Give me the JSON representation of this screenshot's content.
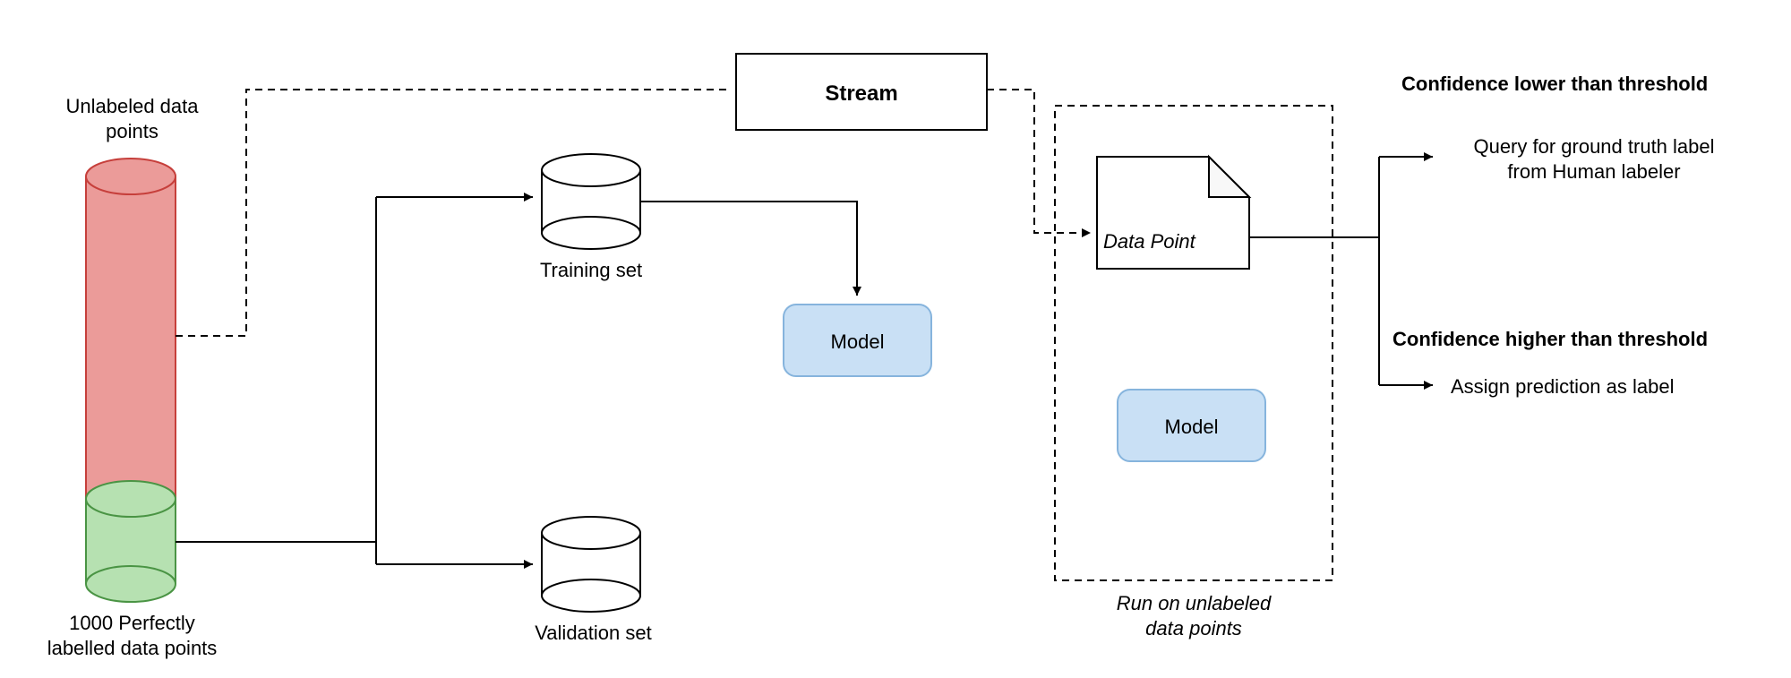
{
  "labels": {
    "unlabeled_title": "Unlabeled data\npoints",
    "labeled_title": "1000 Perfectly\nlabelled data points",
    "training_set": "Training set",
    "validation_set": "Validation set",
    "model_top": "Model",
    "model_bottom": "Model",
    "stream": "Stream",
    "data_point": "Data Point",
    "run_caption": "Run on unlabeled\ndata points",
    "conf_low_title": "Confidence lower than threshold",
    "conf_low_sub": "Query for ground truth label\nfrom Human labeler",
    "conf_high_title": "Confidence higher than threshold",
    "conf_high_sub": "Assign prediction as label"
  },
  "colors": {
    "red_fill": "#eb9b99",
    "red_stroke": "#c63f3b",
    "green_fill": "#b6e1b1",
    "green_stroke": "#4a9444",
    "blue_fill": "#c9e0f5",
    "blue_stroke": "#86b4dd",
    "page_fill": "#f8f8f8",
    "line": "#000000"
  }
}
